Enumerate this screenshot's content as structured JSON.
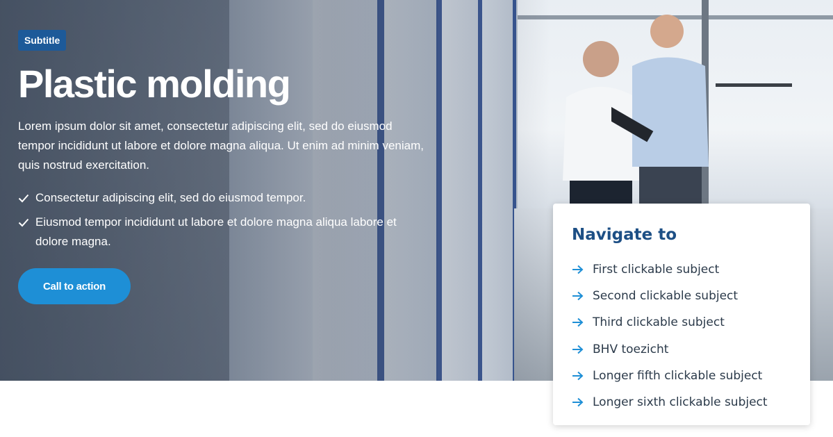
{
  "hero": {
    "badge": "Subtitle",
    "title": "Plastic molding",
    "intro": "Lorem ipsum dolor sit amet, consectetur adipiscing elit, sed do eiusmod tempor incididunt ut labore et dolore magna aliqua. Ut enim ad minim veniam, quis nostrud exercitation.",
    "checklist": [
      "Consectetur adipiscing elit, sed do eiusmod tempor.",
      "Eiusmod tempor incididunt ut labore et dolore magna aliqua labore et dolore magna."
    ],
    "cta_label": "Call to action"
  },
  "nav": {
    "title": "Navigate to",
    "items": [
      "First clickable subject",
      "Second clickable subject",
      "Third clickable subject",
      "BHV toezicht",
      "Longer fifth clickable subject",
      "Longer sixth clickable subject"
    ]
  },
  "colors": {
    "badge_bg": "#1d5a99",
    "cta_bg": "#1e8fd6",
    "nav_title": "#1d4f85",
    "arrow": "#1e8fd6"
  },
  "icons": {
    "check": "check-icon",
    "arrow": "arrow-right-icon"
  }
}
